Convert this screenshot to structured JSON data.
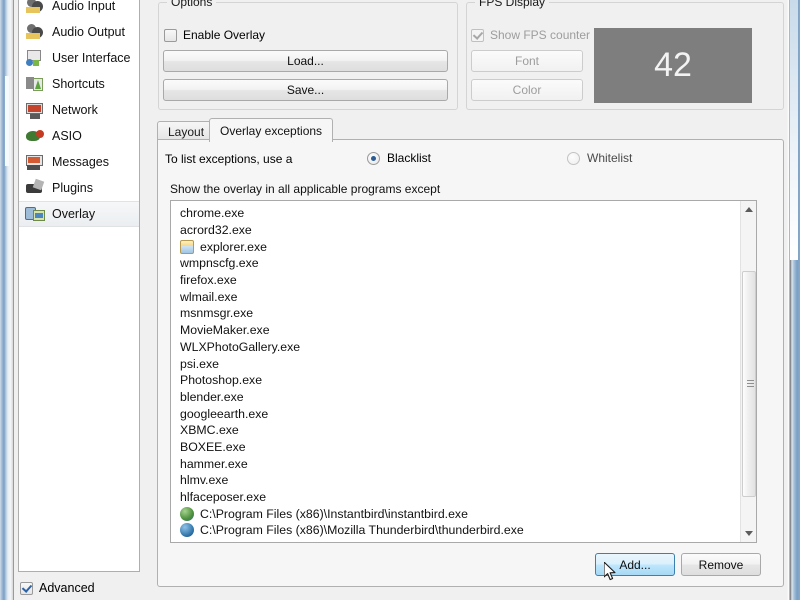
{
  "sidebar": {
    "items": [
      {
        "label": "Audio Input",
        "icon": "audio-input-icon",
        "selected": false
      },
      {
        "label": "Audio Output",
        "icon": "audio-output-icon",
        "selected": false
      },
      {
        "label": "User Interface",
        "icon": "user-interface-icon",
        "selected": false
      },
      {
        "label": "Shortcuts",
        "icon": "shortcuts-icon",
        "selected": false
      },
      {
        "label": "Network",
        "icon": "network-icon",
        "selected": false
      },
      {
        "label": "ASIO",
        "icon": "asio-icon",
        "selected": false
      },
      {
        "label": "Messages",
        "icon": "messages-icon",
        "selected": false
      },
      {
        "label": "Plugins",
        "icon": "plugins-icon",
        "selected": false
      },
      {
        "label": "Overlay",
        "icon": "overlay-icon",
        "selected": true
      }
    ],
    "advanced": {
      "label": "Advanced",
      "checked": true
    }
  },
  "options_group": {
    "title": "Options",
    "enable_overlay": {
      "label": "Enable Overlay",
      "checked": false
    },
    "load_label": "Load...",
    "save_label": "Save..."
  },
  "fps_group": {
    "title": "FPS Display",
    "show_fps": {
      "label": "Show FPS counter",
      "checked": true,
      "disabled": true
    },
    "font_label": "Font",
    "color_label": "Color",
    "preview_value": "42",
    "preview_bg": "#7e7e7e",
    "preview_fg": "#f3f3f3"
  },
  "tabs": [
    {
      "label": "Layout",
      "active": false
    },
    {
      "label": "Overlay exceptions",
      "active": true
    }
  ],
  "exceptions_panel": {
    "list_type_label": "To list exceptions, use a",
    "blacklist": {
      "label": "Blacklist",
      "selected": true
    },
    "whitelist": {
      "label": "Whitelist",
      "selected": false
    },
    "list_hint": "Show the overlay in all applicable programs except",
    "items": [
      {
        "text": "chrome.exe",
        "icon": null
      },
      {
        "text": "acrord32.exe",
        "icon": null
      },
      {
        "text": "explorer.exe",
        "icon": "explorer-icon"
      },
      {
        "text": "wmpnscfg.exe",
        "icon": null
      },
      {
        "text": "firefox.exe",
        "icon": null
      },
      {
        "text": "wlmail.exe",
        "icon": null
      },
      {
        "text": "msnmsgr.exe",
        "icon": null
      },
      {
        "text": "MovieMaker.exe",
        "icon": null
      },
      {
        "text": "WLXPhotoGallery.exe",
        "icon": null
      },
      {
        "text": "psi.exe",
        "icon": null
      },
      {
        "text": "Photoshop.exe",
        "icon": null
      },
      {
        "text": "blender.exe",
        "icon": null
      },
      {
        "text": "googleearth.exe",
        "icon": null
      },
      {
        "text": "XBMC.exe",
        "icon": null
      },
      {
        "text": "BOXEE.exe",
        "icon": null
      },
      {
        "text": "hammer.exe",
        "icon": null
      },
      {
        "text": "hlmv.exe",
        "icon": null
      },
      {
        "text": "hlfaceposer.exe",
        "icon": null
      },
      {
        "text": "C:\\Program Files (x86)\\Instantbird\\instantbird.exe",
        "icon": "instantbird-icon"
      },
      {
        "text": "C:\\Program Files (x86)\\Mozilla Thunderbird\\thunderbird.exe",
        "icon": "thunderbird-icon"
      }
    ],
    "add_label": "Add...",
    "remove_label": "Remove",
    "add_hovered": true,
    "scrollbar": {
      "up": "scroll-up-arrow",
      "down": "scroll-down-arrow"
    }
  },
  "colors": {
    "window_bg": "#f0f0f0",
    "panel_bg": "#f6f6f6",
    "list_bg": "#ffffff",
    "accent": "#2c5c93",
    "hover_border": "#3c7fb1"
  }
}
